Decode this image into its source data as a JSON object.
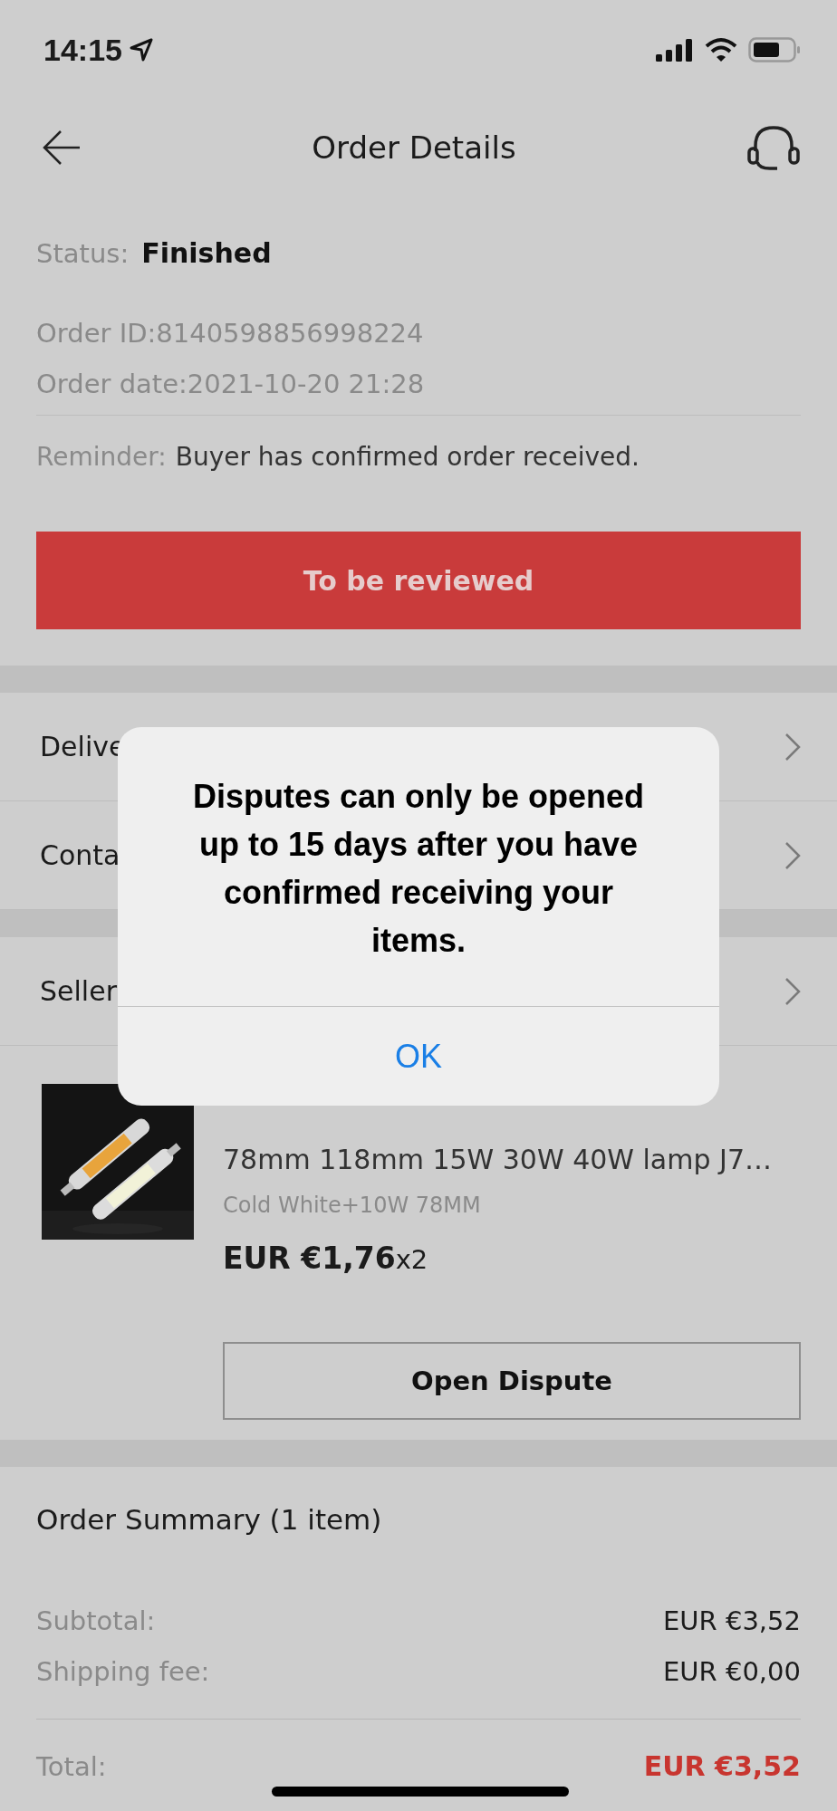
{
  "status_bar": {
    "time": "14:15"
  },
  "header": {
    "title": "Order Details"
  },
  "order": {
    "status_label": "Status:",
    "status": "Finished",
    "order_id": "Order ID:8140598856998224",
    "order_date": "Order date:2021-10-20 21:28",
    "reminder_label": "Reminder:",
    "reminder": "Buyer has confirmed order received."
  },
  "review_button": "To be reviewed",
  "sections": [
    {
      "rows": [
        {
          "label": "Delive"
        },
        {
          "label": "Conta"
        }
      ]
    },
    {
      "rows": [
        {
          "label": "Seller"
        }
      ]
    }
  ],
  "product": {
    "title": "78mm 118mm 15W 30W 40W lamp J7…",
    "variant": "Cold White+10W 78MM",
    "price": "EUR €1,76",
    "quantity": "x2"
  },
  "dispute_button": "Open Dispute",
  "summary": {
    "title": "Order Summary (1 item)",
    "lines": [
      {
        "label": "Subtotal:",
        "value": "EUR €3,52"
      },
      {
        "label": "Shipping fee:",
        "value": "EUR €0,00"
      }
    ],
    "total_label": "Total:",
    "total": "EUR €3,52"
  },
  "alert": {
    "message": "Disputes can only be opened up to 15 days after you have confirmed receiving your items.",
    "button": "OK"
  }
}
